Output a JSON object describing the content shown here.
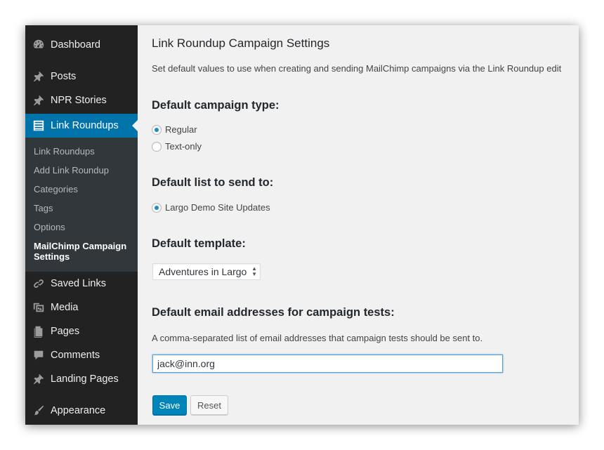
{
  "sidebar": {
    "top_items": [
      {
        "label": "Dashboard",
        "icon": "dashboard-icon"
      },
      {
        "label": "Posts",
        "icon": "pushpin-icon"
      },
      {
        "label": "NPR Stories",
        "icon": "pushpin-icon"
      },
      {
        "label": "Link Roundups",
        "icon": "list-icon",
        "active": true
      }
    ],
    "submenu": [
      {
        "label": "Link Roundups"
      },
      {
        "label": "Add Link Roundup"
      },
      {
        "label": "Categories"
      },
      {
        "label": "Tags"
      },
      {
        "label": "Options"
      },
      {
        "label": "MailChimp Campaign Settings",
        "current": true
      }
    ],
    "bottom_items": [
      {
        "label": "Saved Links",
        "icon": "link-icon"
      },
      {
        "label": "Media",
        "icon": "media-icon"
      },
      {
        "label": "Pages",
        "icon": "pages-icon"
      },
      {
        "label": "Comments",
        "icon": "comment-icon"
      },
      {
        "label": "Landing Pages",
        "icon": "pushpin-icon"
      },
      {
        "label": "Appearance",
        "icon": "paintbrush-icon"
      }
    ],
    "colors": {
      "background": "#222222",
      "submenu": "#32373c",
      "active": "#0073aa"
    }
  },
  "main": {
    "title": "Link Roundup Campaign Settings",
    "description": "Set default values to use when creating and sending MailChimp campaigns via the Link Roundup edit",
    "campaign_type": {
      "heading": "Default campaign type:",
      "options": [
        {
          "label": "Regular",
          "checked": true
        },
        {
          "label": "Text-only",
          "checked": false
        }
      ]
    },
    "list": {
      "heading": "Default list to send to:",
      "options": [
        {
          "label": "Largo Demo Site Updates",
          "checked": true
        }
      ]
    },
    "template": {
      "heading": "Default template:",
      "selected": "Adventures in Largo"
    },
    "emails": {
      "heading": "Default email addresses for campaign tests:",
      "hint": "A comma-separated list of email addresses that campaign tests should be sent to.",
      "value": "jack@inn.org"
    },
    "buttons": {
      "save": "Save",
      "reset": "Reset"
    }
  }
}
